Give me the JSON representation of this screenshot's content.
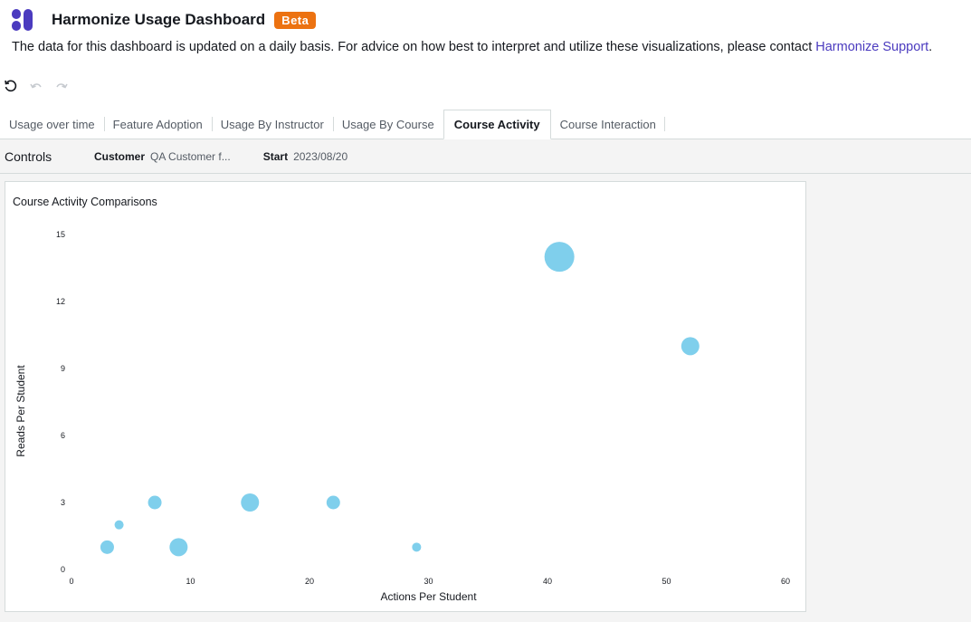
{
  "header": {
    "title": "Harmonize Usage Dashboard",
    "badge": "Beta",
    "description": "The data for this dashboard is updated on a daily basis. For advice on how best to interpret and utilize these visualizations, please contact ",
    "support_link": "Harmonize Support",
    "description_end": "."
  },
  "tabs": [
    {
      "label": "Usage over time"
    },
    {
      "label": "Feature Adoption"
    },
    {
      "label": "Usage By Instructor"
    },
    {
      "label": "Usage By Course"
    },
    {
      "label": "Course Activity",
      "active": true
    },
    {
      "label": "Course Interaction"
    }
  ],
  "controls": {
    "label": "Controls",
    "customer_label": "Customer",
    "customer_value": "QA Customer f...",
    "start_label": "Start",
    "start_value": "2023/08/20"
  },
  "chart": {
    "title": "Course Activity Comparisons"
  },
  "colors": {
    "bubble": "#7fcfec",
    "accent": "#ec7211",
    "link": "#4b3bbf",
    "logo": "#4b3bbf"
  },
  "chart_data": {
    "type": "scatter",
    "xlabel": "Actions Per Student",
    "ylabel": "Reads Per Student",
    "xlim": [
      0,
      60
    ],
    "ylim": [
      0,
      15
    ],
    "xticks": [
      0,
      10,
      20,
      30,
      40,
      50,
      60
    ],
    "yticks": [
      0,
      3,
      6,
      9,
      12,
      15
    ],
    "grid": false,
    "points": [
      {
        "x": 41,
        "y": 14,
        "size": 5
      },
      {
        "x": 52,
        "y": 10,
        "size": 3
      },
      {
        "x": 7,
        "y": 3,
        "size": 2
      },
      {
        "x": 15,
        "y": 3,
        "size": 3
      },
      {
        "x": 22,
        "y": 3,
        "size": 2
      },
      {
        "x": 4,
        "y": 2,
        "size": 1
      },
      {
        "x": 3,
        "y": 1,
        "size": 2
      },
      {
        "x": 9,
        "y": 1,
        "size": 3
      },
      {
        "x": 29,
        "y": 1,
        "size": 1
      }
    ]
  }
}
